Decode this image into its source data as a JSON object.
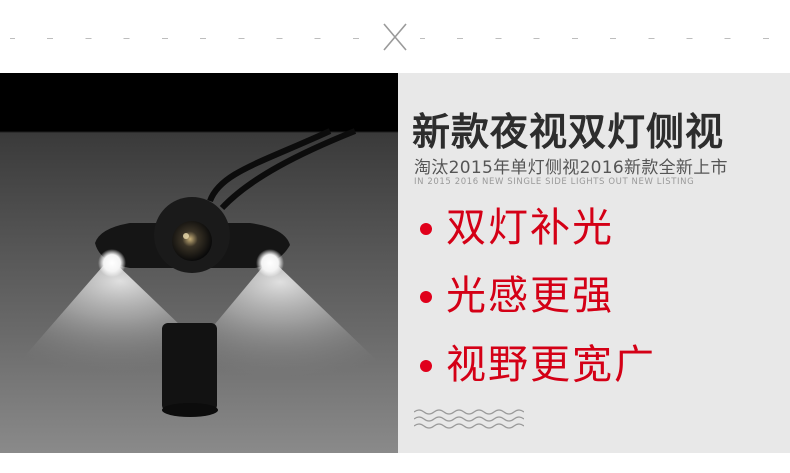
{
  "divider": {
    "mark": "X"
  },
  "photo": {
    "subject": "camera-photo",
    "mount": "black-mount-icon"
  },
  "panel": {
    "title": "新款夜视双灯侧视",
    "subtitle": "淘汰2015年单灯侧视2016新款全新上市",
    "english": "IN 2015 2016 NEW SINGLE SIDE LIGHTS OUT NEW LISTING",
    "features": [
      {
        "label": "双灯补光"
      },
      {
        "label": "光感更强"
      },
      {
        "label": "视野更宽广"
      }
    ],
    "accent_color": "#d40016",
    "dot_color": "#e0001b",
    "panel_bg": "#e8e8e8"
  }
}
